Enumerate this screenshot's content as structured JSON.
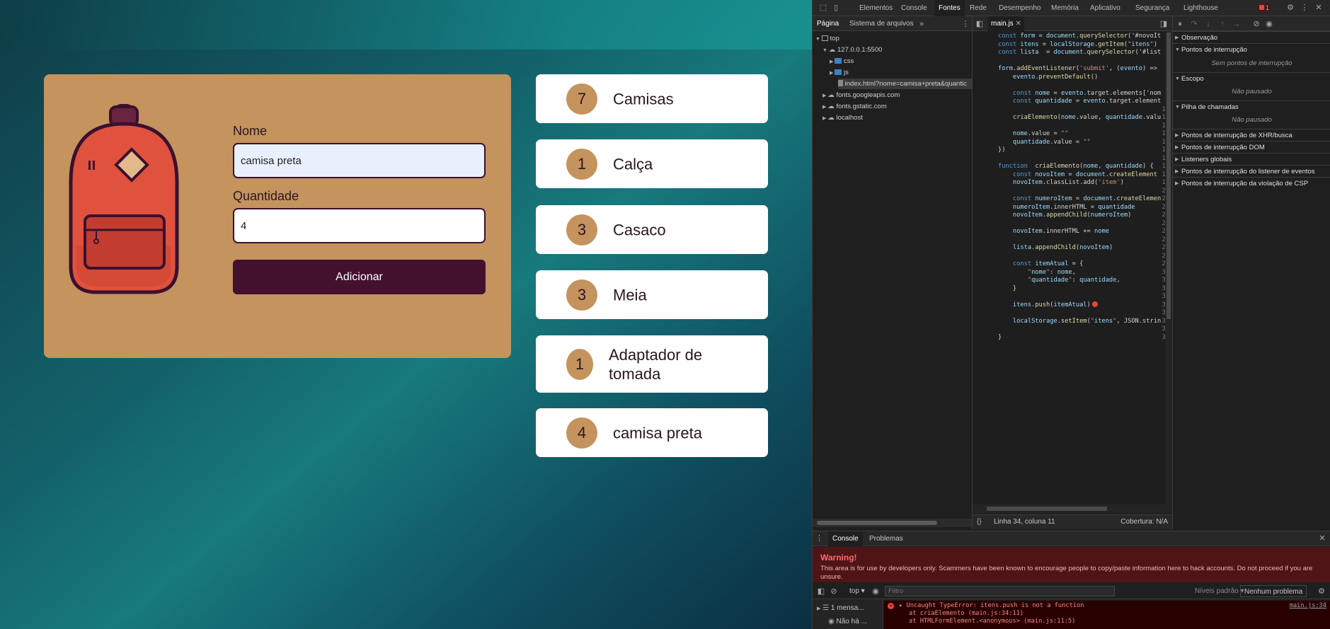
{
  "app": {
    "form": {
      "name_label": "Nome",
      "name_value": "camisa preta",
      "qty_label": "Quantidade",
      "qty_value": "4",
      "submit_label": "Adicionar"
    },
    "items": [
      {
        "qty": "7",
        "name": "Camisas"
      },
      {
        "qty": "1",
        "name": "Calça"
      },
      {
        "qty": "3",
        "name": "Casaco"
      },
      {
        "qty": "3",
        "name": "Meia"
      },
      {
        "qty": "1",
        "name": "Adaptador de tomada"
      },
      {
        "qty": "4",
        "name": "camisa preta"
      }
    ],
    "colors": {
      "card": "#c4935e",
      "button": "#43112e",
      "bag": "#e0523d"
    }
  },
  "devtools": {
    "tabs": [
      "Elementos",
      "Console",
      "Fontes",
      "Rede",
      "Desempenho",
      "Memória",
      "Aplicativo",
      "Segurança",
      "Lighthouse"
    ],
    "active_tab": "Fontes",
    "error_badge": "1",
    "nav_tabs": [
      "Página",
      "Sistema de arquivos"
    ],
    "tree": [
      "top",
      "127.0.0.1:5500",
      "css",
      "js",
      "index.html?nome=camisa+preta&quantic",
      "fonts.googleapis.com",
      "fonts.gstatic.com",
      "localhost"
    ],
    "open_file": "main.js",
    "code_lines": [
      "const form = document.querySelector('#novoIt",
      "const itens = localStorage.getItem(\"itens\")",
      "const lista  = document.querySelector('#list",
      "",
      "form.addEventListener('submit', (evento) =>",
      "    evento.preventDefault()",
      "",
      "    const nome = evento.target.elements['nom",
      "    const quantidade = evento.target.element",
      "",
      "    criaElemento(nome.value, quantidade.valu",
      "",
      "    nome.value = \"\"",
      "    quantidade.value = \"\"",
      "})",
      "",
      "function  criaElemento(nome, quantidade) {",
      "    const novoItem = document.createElement",
      "    novoItem.classList.add('item')",
      "",
      "    const numeroItem = document.createElemen",
      "    numeroItem.innerHTML = quantidade",
      "    novoItem.appendChild(numeroItem)",
      "",
      "    novoItem.innerHTML += nome",
      "",
      "    lista.appendChild(novoItem)",
      "",
      "    const itemAtual = {",
      "        \"nome\": nome,",
      "        \"quantidade\": quantidade,",
      "    }",
      "",
      "    itens.push(itemAtual)",
      "",
      "    localStorage.setItem(\"itens\", JSON.strin",
      "",
      "}"
    ],
    "status_position": "Linha 34, coluna 11",
    "status_coverage": "Cobertura: N/A",
    "side_sections": [
      {
        "label": "Observação",
        "open": false
      },
      {
        "label": "Pontos de interrupção",
        "open": true,
        "msg": "Sem pontos de interrupção"
      },
      {
        "label": "Escopo",
        "open": true,
        "msg": "Não pausado"
      },
      {
        "label": "Pilha de chamadas",
        "open": true,
        "msg": "Não pausado"
      },
      {
        "label": "Pontos de interrupção de XHR/busca",
        "open": false
      },
      {
        "label": "Pontos de interrupção DOM",
        "open": false
      },
      {
        "label": "Listeners globais",
        "open": false
      },
      {
        "label": "Pontos de interrupção do listener de eventos",
        "open": false
      },
      {
        "label": "Pontos de interrupção da violação de CSP",
        "open": false
      }
    ],
    "drawer_tabs": [
      "Console",
      "Problemas"
    ],
    "warning_title": "Warning!",
    "warning_text": "This area is for use by developers only. Scammers have been known to encourage people to copy/paste information here to hack accounts. Do not proceed if you are unsure.",
    "console_context": "top",
    "filter_placeholder": "Filtro",
    "levels": "Níveis padrão ▾",
    "issues": "Nenhum problema",
    "sidebar_messages": "1 mensa...",
    "sidebar_user": "Não há ...",
    "error_lines": [
      "▸ Uncaught TypeError: itens.push is not a function",
      "at criaElemento (main.js:34:11)",
      "at HTMLFormElement.<anonymous> (main.js:11:5)"
    ],
    "error_link": "main.js:34"
  }
}
